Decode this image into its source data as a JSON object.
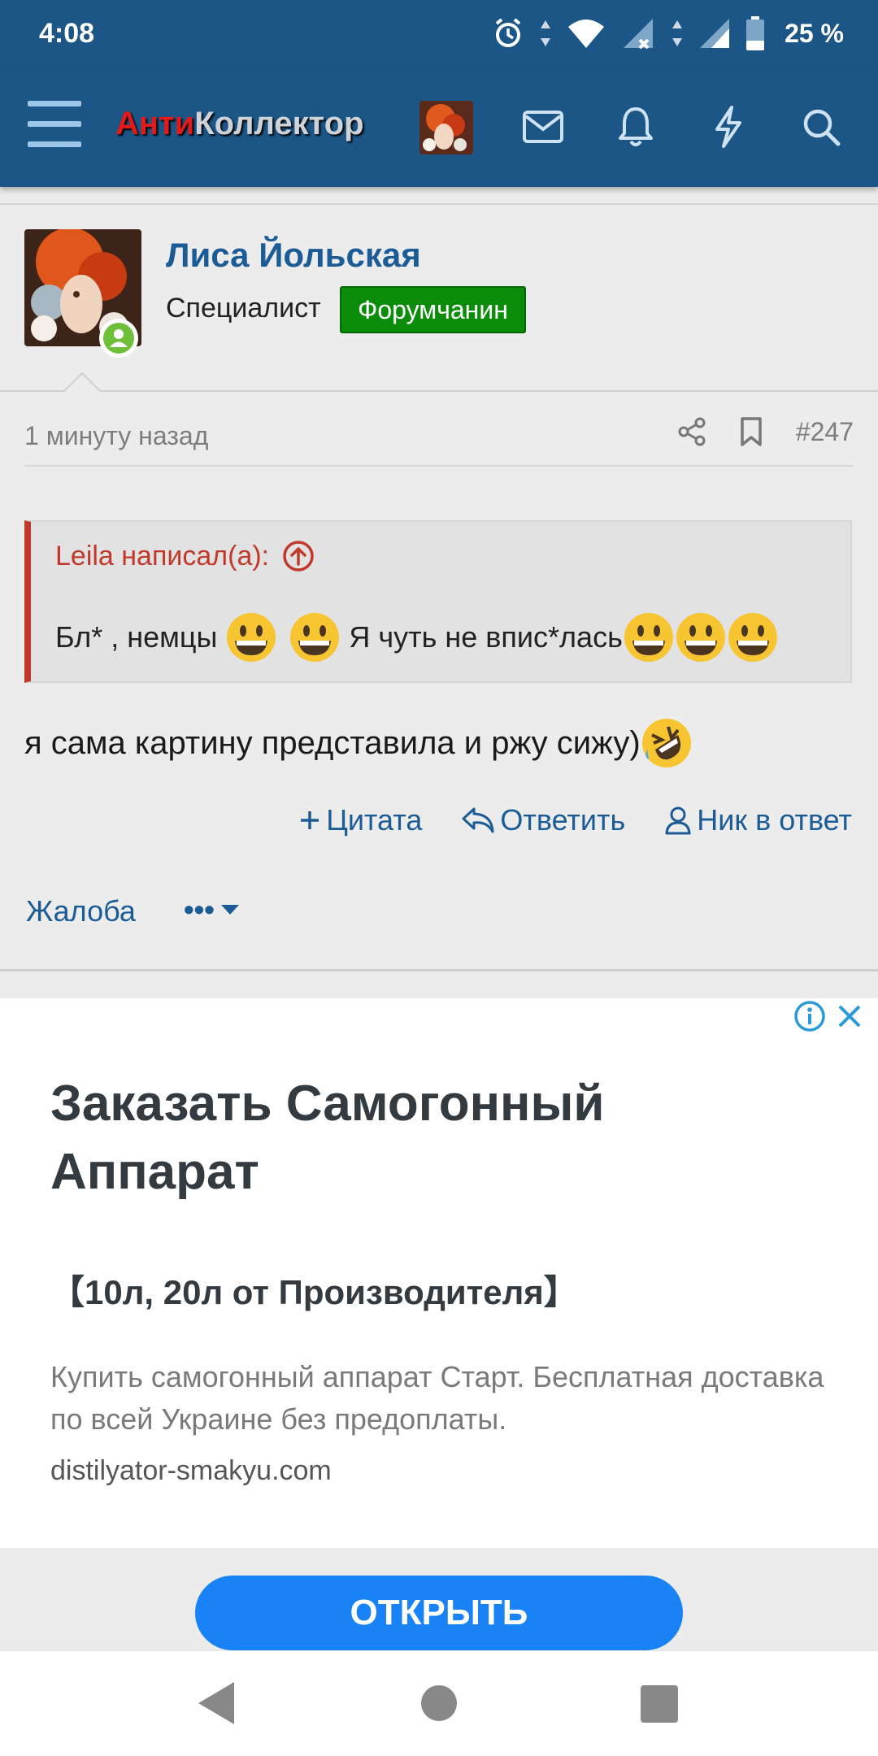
{
  "status_bar": {
    "time": "4:08",
    "battery": "25 %",
    "icons": [
      "alarm-icon",
      "wifi-icon",
      "signal-icon",
      "signal-icon",
      "battery-icon"
    ]
  },
  "header": {
    "logo_red": "Анти",
    "logo_rest": "Коллектор",
    "icons": [
      "menu-icon",
      "avatar",
      "mail-icon",
      "bell-icon",
      "bolt-icon",
      "search-icon"
    ]
  },
  "post": {
    "username": "Лиса Йольская",
    "user_title": "Специалист",
    "user_badge": "Форумчанин",
    "time": "1 минуту назад",
    "number": "#247",
    "quote_author": "Leila написал(а):",
    "quote_part1": "Бл* , немцы",
    "quote_part2": "Я чуть не впис*лась",
    "message": "я сама картину представила и ржу сижу)",
    "actions": {
      "quote": "Цитата",
      "reply": "Ответить",
      "nick": "Ник в ответ"
    },
    "complain": "Жалоба",
    "more": "•••"
  },
  "ad": {
    "title": "Заказать Самогонный Аппарат",
    "subtitle": "【10л, 20л от Производителя】",
    "description": "Купить самогонный аппарат Старт. Бесплатная доставка по всей Украине без предоплаты.",
    "url": "distilyator-smakyu.com",
    "button": "ОТКРЫТЬ"
  },
  "colors": {
    "header_bg": "#1b5687",
    "link": "#1c5c96",
    "quote_accent": "#c0392b",
    "badge_green": "#0b8c0b",
    "ad_button": "#1a82f7"
  }
}
